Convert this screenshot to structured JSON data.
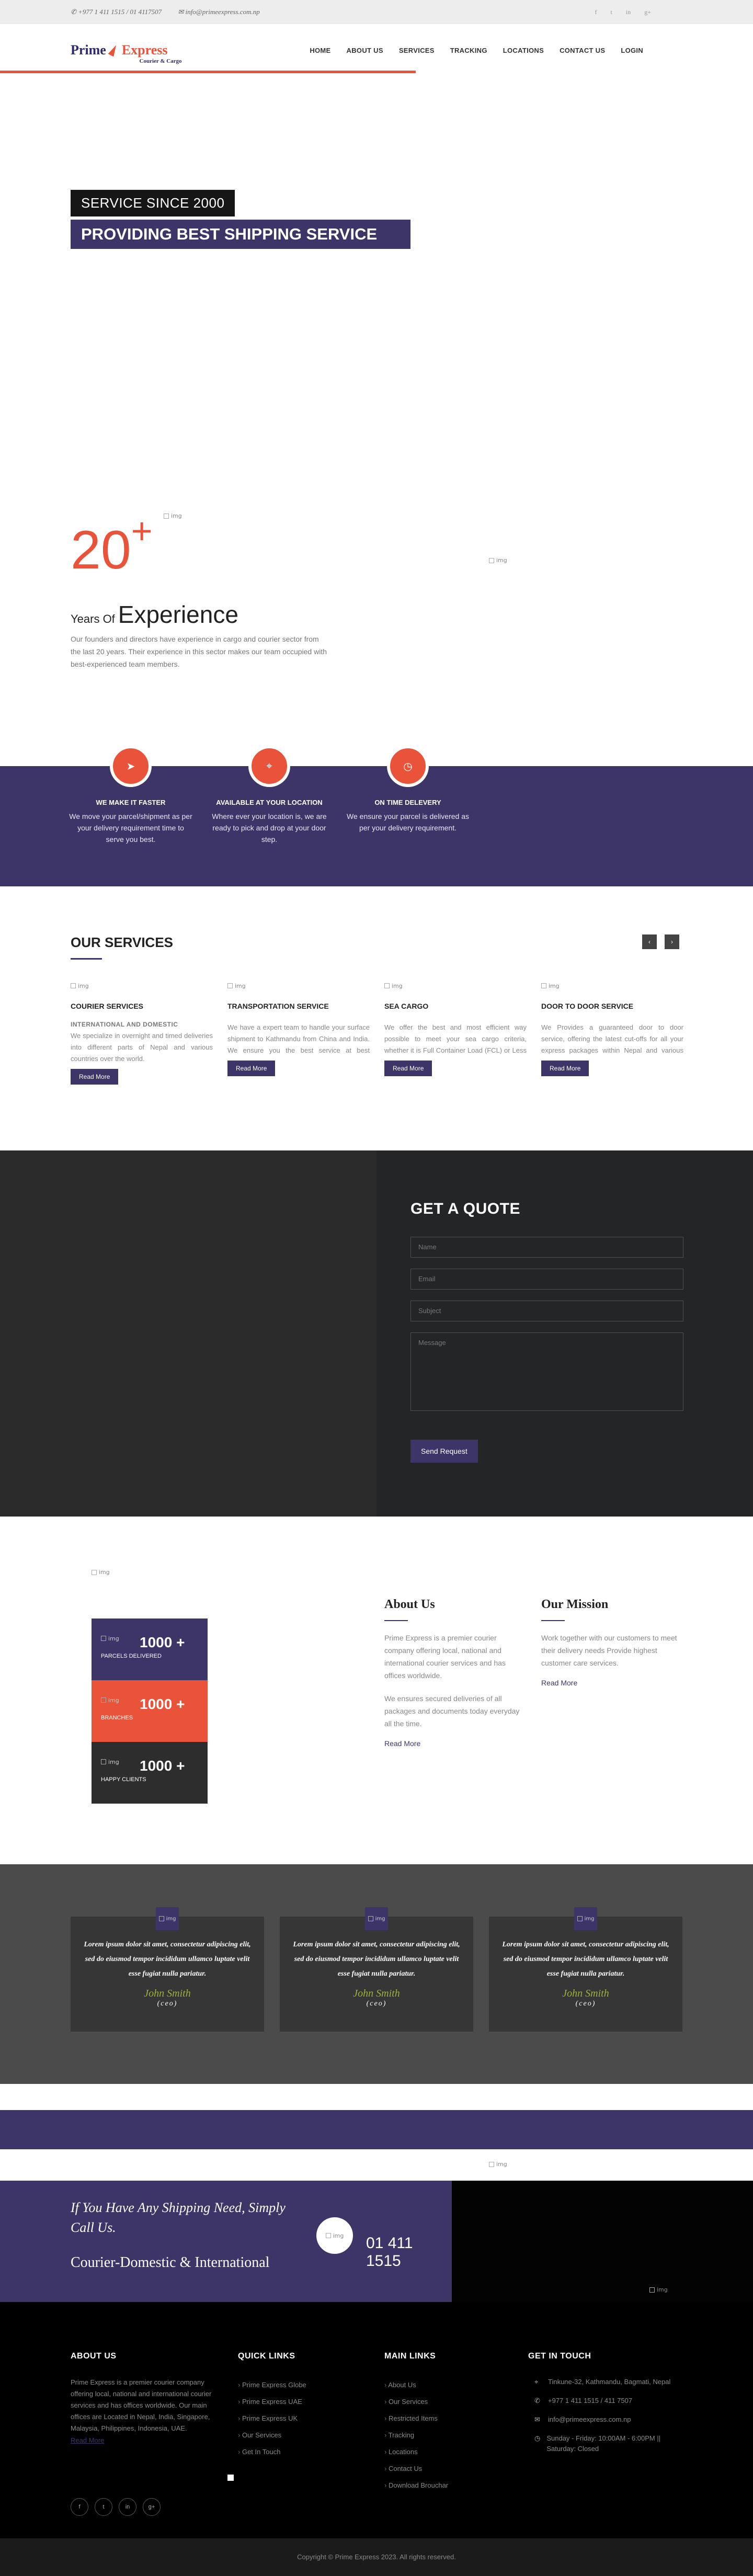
{
  "topbar": {
    "phone": "+977 1 411 1515 / 01 4117507",
    "email": "info@primeexpress.com.np",
    "social_icons": [
      "facebook-icon",
      "twitter-icon",
      "linkedin-icon",
      "google-plus-icon"
    ]
  },
  "logo": {
    "prime": "Prime",
    "express": "Express",
    "tagline": "Courier & Cargo"
  },
  "nav": [
    "HOME",
    "ABOUT US",
    "SERVICES",
    "TRACKING",
    "LOCATIONS",
    "CONTACT US",
    "LOGIN"
  ],
  "hero": {
    "tag": "SERVICE SINCE 2000",
    "title": "PROVIDING BEST SHIPPING SERVICE",
    "img_alt": "img"
  },
  "experience": {
    "number": "20",
    "plus": "+",
    "years_of": "Years Of",
    "experience": "Experience",
    "text": "Our founders and directors have experience in cargo and courier sector from the last 20 years. Their experience in this sector makes our team occupied with best-experienced team members.",
    "img_alt": "img"
  },
  "features": [
    {
      "title": "WE MAKE IT FASTER",
      "text": "We move your parcel/shipment as per your delivery requirement time to serve you best."
    },
    {
      "title": "AVAILABLE AT YOUR LOCATION",
      "text": "Where ever your location is, we are ready to pick and drop at your door step."
    },
    {
      "title": "ON TIME DELEVERY",
      "text": "We ensure your parcel is delivered as per your delivery requirement."
    }
  ],
  "services": {
    "heading": "OUR SERVICES",
    "read_more": "Read More",
    "img_alt": "img",
    "items": [
      {
        "title": "COURIER SERVICES",
        "sub": "INTERNATIONAL AND DOMESTIC",
        "text": "We specialize in overnight and timed deliveries into different parts of Nepal and various countries over the world."
      },
      {
        "title": "TRANSPORTATION SERVICE",
        "sub": "",
        "text": "We have a expert team to handle your surface shipment to Kathmandu from China and India. We ensure you the best service at best possible rates for your shipments."
      },
      {
        "title": "SEA CARGO",
        "sub": "",
        "text": "We offer the best and most efficient way possible to meet your sea cargo criteria, whether it is Full Container Load (FCL) or Less than Container Load (LCL)."
      },
      {
        "title": "DOOR TO DOOR SERVICE",
        "sub": "",
        "text": "We Provides a guaranteed door to door service, offering the latest cut-offs for all your express packages within Nepal and various countries around the world."
      }
    ]
  },
  "quote": {
    "heading": "GET A QUOTE",
    "name_ph": "Name",
    "email_ph": "Email",
    "subject_ph": "Subject",
    "message_ph": "Message",
    "button": "Send Request"
  },
  "about": {
    "img_alt": "img",
    "stats": [
      {
        "num": "1000 +",
        "label": "PARCELS DELIVERED",
        "color": "#3d3568"
      },
      {
        "num": "1000 +",
        "label": "BRANCHES",
        "color": "#e9533a"
      },
      {
        "num": "1000 +",
        "label": "HAPPY CLIENTS",
        "color": "#2d2d2d"
      }
    ],
    "about_title": "About Us",
    "about_p1": "Prime Express is a premier courier company offering local, national and international courier services and has offices worldwide.",
    "about_p2": "We ensures secured deliveries of all packages and documents today everyday all the time.",
    "mission_title": "Our Mission",
    "mission_p": "Work together with our customers to meet their delivery needs Provide highest customer care services.",
    "read_more": "Read More"
  },
  "testimonials": [
    {
      "text": "Lorem ipsum dolor sit amet, consectetur adipiscing elit, sed do eiusmod tempor incididum ullamco luptate velit esse fugiat nulla pariatur.",
      "name": "John Smith",
      "role": "(ceo)",
      "img_alt": "img"
    },
    {
      "text": "Lorem ipsum dolor sit amet, consectetur adipiscing elit, sed do eiusmod tempor incididum ullamco luptate velit esse fugiat nulla pariatur.",
      "name": "John Smith",
      "role": "(ceo)",
      "img_alt": "img"
    },
    {
      "text": "Lorem ipsum dolor sit amet, consectetur adipiscing elit, sed do eiusmod tempor incididum ullamco luptate velit esse fugiat nulla pariatur.",
      "name": "John Smith",
      "role": "(ceo)",
      "img_alt": "img"
    }
  ],
  "band_img_alt": "img",
  "cta": {
    "line1": "If You Have Any Shipping Need, Simply Call Us.",
    "line2": "Courier-Domestic & International",
    "phone": "01 411 1515",
    "img_alt": "img"
  },
  "footer": {
    "about_title": "ABOUT US",
    "about_text": "Prime Express is a premier courier company offering local, national and international courier services and has offices worldwide. Our main offices are Located in Nepal, India, Singapore, Malaysia, Philippines, Indonesia, UAE.",
    "read_more": "Read More",
    "quick_title": "QUICK LINKS",
    "quick_links": [
      "Prime Express Globe",
      "Prime Express UAE",
      "Prime Express UK",
      "Our Services",
      "Get In Touch"
    ],
    "main_title": "MAIN LINKS",
    "main_links": [
      "About Us",
      "Our Services",
      "Restricted Items",
      "Tracking",
      "Locations",
      "Contact Us",
      "Download Brouchar"
    ],
    "touch_title": "GET IN TOUCH",
    "contacts": [
      {
        "icon": "location-icon",
        "text": "Tinkune-32, Kathmandu, Bagmati, Nepal"
      },
      {
        "icon": "phone-icon",
        "text": "+977 1 411 1515 / 411 7507"
      },
      {
        "icon": "mail-icon",
        "text": "info@primeexpress.com.np"
      },
      {
        "icon": "clock-icon",
        "text": "Sunday - Friday: 10:00AM - 6:00PM || Saturday: Closed"
      }
    ],
    "social_icons": [
      "facebook-icon",
      "twitter-icon",
      "linkedin-icon",
      "google-plus-icon"
    ]
  },
  "copyright": "Copyright © Prime Express 2023. All rights reserved."
}
